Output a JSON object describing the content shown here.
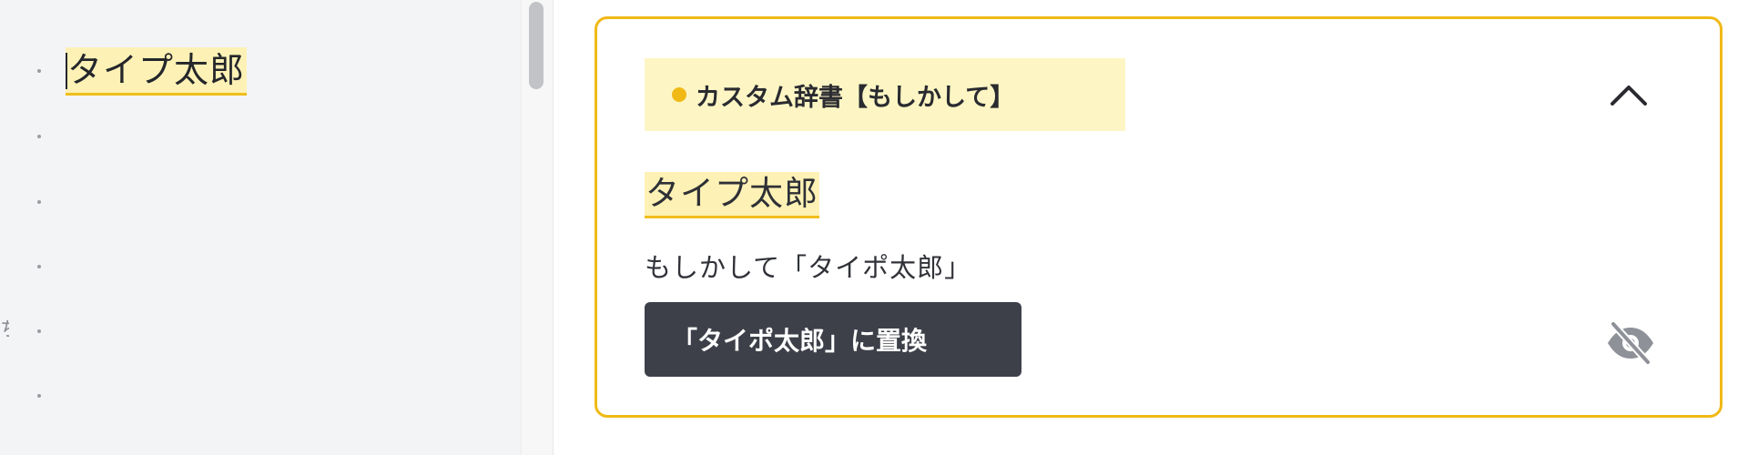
{
  "editor": {
    "text": "タイプ太郎",
    "gutter_fragment": "ち"
  },
  "card": {
    "category_label": "カスタム辞書【もしかして】",
    "flagged_word": "タイプ太郎",
    "suggestion": "もしかして「タイポ太郎」",
    "replace_button_label": "「タイポ太郎」に置換",
    "accent_color": "#f0b915",
    "highlight_color": "#fdf1b5",
    "button_color": "#3d4049"
  },
  "icons": {
    "collapse": "chevron-up-icon",
    "ignore": "eye-off-icon",
    "category_marker": "dot-icon"
  }
}
